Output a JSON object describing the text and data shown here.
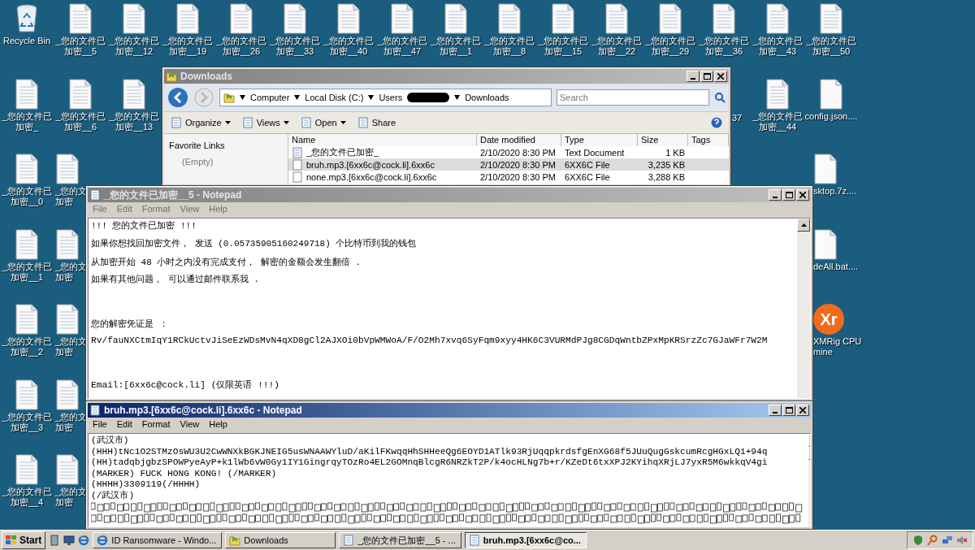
{
  "desktop_icons": [
    {
      "kind": "recycle_bin",
      "lines": [
        "Recycle Bin"
      ]
    },
    {
      "kind": "text_file",
      "lines": [
        "_您的文件已",
        "加密__5"
      ]
    },
    {
      "kind": "text_file",
      "lines": [
        "_您的文件已",
        "加密__12"
      ]
    },
    {
      "kind": "text_file",
      "lines": [
        "_您的文件已",
        "加密__19"
      ]
    },
    {
      "kind": "text_file",
      "lines": [
        "_您的文件已",
        "加密__26"
      ]
    },
    {
      "kind": "text_file",
      "lines": [
        "_您的文件已",
        "加密__33"
      ]
    },
    {
      "kind": "text_file",
      "lines": [
        "_您的文件已",
        "加密__40"
      ]
    },
    {
      "kind": "text_file",
      "lines": [
        "_您的文件已",
        "加密__47"
      ]
    },
    {
      "kind": "text_file",
      "lines": [
        "_您的文件已",
        "加密__1"
      ]
    },
    {
      "kind": "text_file",
      "lines": [
        "_您的文件已",
        "加密__8"
      ]
    },
    {
      "kind": "text_file",
      "lines": [
        "_您的文件已",
        "加密__15"
      ]
    },
    {
      "kind": "text_file",
      "lines": [
        "_您的文件已",
        "加密__22"
      ]
    },
    {
      "kind": "text_file",
      "lines": [
        "_您的文件已",
        "加密__29"
      ]
    },
    {
      "kind": "text_file",
      "lines": [
        "_您的文件已",
        "加密__36"
      ]
    },
    {
      "kind": "text_file",
      "lines": [
        "_您的文件已",
        "加密__43"
      ]
    },
    {
      "kind": "text_file",
      "lines": [
        "_您的文件已",
        "加密__50"
      ]
    },
    {
      "kind": "text_file",
      "lines": [
        "_您的文件已",
        "加密_"
      ]
    },
    {
      "kind": "text_file",
      "lines": [
        "_您的文件已",
        "加密__6"
      ]
    },
    {
      "kind": "text_file",
      "lines": [
        "_您的文件已",
        "加密__13"
      ]
    },
    {
      "kind": "text_file",
      "lines": [
        "37"
      ]
    },
    {
      "kind": "text_file",
      "lines": [
        "_您的文件已",
        "加密__44"
      ]
    },
    {
      "kind": "blank_file",
      "lines": [
        "config.json...."
      ]
    },
    {
      "kind": "text_file",
      "lines": [
        "_您的文件已",
        "加密__0"
      ]
    },
    {
      "kind": "text_file",
      "lines": [
        "_您的文",
        "加密"
      ]
    },
    {
      "kind": "blank_file",
      "lines": [
        "sktop.7z...."
      ]
    },
    {
      "kind": "text_file",
      "lines": [
        "_您的文件已",
        "加密__1"
      ]
    },
    {
      "kind": "text_file",
      "lines": [
        "_您的文",
        "加密"
      ]
    },
    {
      "kind": "blank_file",
      "lines": [
        "deAll.bat...."
      ]
    },
    {
      "kind": "text_file",
      "lines": [
        "_您的文件已",
        "加密__2"
      ]
    },
    {
      "kind": "text_file",
      "lines": [
        "_您的文",
        "加密"
      ]
    },
    {
      "kind": "app",
      "logo": "Xr",
      "lines": [
        "XMRig CPU",
        "mine"
      ]
    },
    {
      "kind": "text_file",
      "lines": [
        "_您的文件已",
        "加密__3"
      ]
    },
    {
      "kind": "text_file",
      "lines": [
        "_您的文",
        "加密"
      ]
    },
    {
      "kind": "text_file",
      "lines": [
        "_您的文件已",
        "加密__4"
      ]
    },
    {
      "kind": "text_file",
      "lines": [
        "_您的文",
        "加密"
      ]
    }
  ],
  "explorer": {
    "title": "Downloads",
    "active": false,
    "breadcrumb": [
      {
        "kind": "crumb",
        "label": "Computer"
      },
      {
        "kind": "crumb",
        "label": "Local Disk (C:)"
      },
      {
        "kind": "crumb",
        "label": "Users"
      },
      {
        "kind": "redacted"
      },
      {
        "kind": "crumb",
        "label": "Downloads"
      }
    ],
    "search": {
      "placeholder": "Search"
    },
    "toolbar": [
      {
        "label": "Organize",
        "dropdown": true
      },
      {
        "label": "Views",
        "dropdown": true
      },
      {
        "label": "Open",
        "dropdown": true
      },
      {
        "label": "Share",
        "dropdown": false
      }
    ],
    "sidebar": {
      "heading": "Favorite Links",
      "empty_note": "(Empty)"
    },
    "columns": [
      "Name",
      "Date modified",
      "Type",
      "Size",
      "Tags"
    ],
    "rows": [
      {
        "kind": "text",
        "name": "_您的文件已加密_",
        "date": "2/10/2020 8:30 PM",
        "type": "Text Document",
        "size": "1 KB",
        "selected": false
      },
      {
        "kind": "file",
        "name": "bruh.mp3.[6xx6c@cock.li].6xx6c",
        "date": "2/10/2020 8:30 PM",
        "type": "6XX6C File",
        "size": "3,235 KB",
        "selected": true
      },
      {
        "kind": "file",
        "name": "none.mp3.[6xx6c@cock.li].6xx6c",
        "date": "2/10/2020 8:30 PM",
        "type": "6XX6C File",
        "size": "3,288 KB",
        "selected": false
      }
    ]
  },
  "notepads": [
    {
      "title": "_您的文件已加密__5 - Notepad",
      "active": false,
      "menu": [
        "File",
        "Edit",
        "Format",
        "View",
        "Help"
      ],
      "garbled": false,
      "lines": [
        {
          "kind": "note",
          "text": "!!! 您的文件已加密 !!!"
        },
        {
          "kind": "note",
          "text": "如果你想找回加密文件， 发送 (0.05735905160249718) 个比特币到我的钱包"
        },
        {
          "kind": "note",
          "text": "从加密开始 48 小时之内没有完成支付， 解密的金额会发生翻倍 ."
        },
        {
          "kind": "note",
          "text": "如果有其他问题， 可以通过邮件联系我 ."
        },
        {
          "kind": "note",
          "text": "您的解密凭证是 ："
        },
        {
          "kind": "code",
          "text": "Rv/fauNXCtmIqY1RCkUctvJiSeEzWDsMvN4qXD8gCl2AJXOi0bVpWMWoA/F/O2Mh7xvq6SyFqm9xyy4HK6C3VURMdPJg8CGDqWntbZPxMpKRSrzZc7GJaWFr7W2M"
        },
        {
          "kind": "code",
          "text": "Email:[6xx6c@cock.li] (仅限英语 !!!)"
        }
      ]
    },
    {
      "title": "bruh.mp3.[6xx6c@cock.li].6xx6c - Notepad",
      "active": true,
      "menu": [
        "File",
        "Edit",
        "Format",
        "View",
        "Help"
      ],
      "garbled": true,
      "lines": [
        {
          "kind": "code",
          "text": "(武汉市)"
        },
        {
          "kind": "code",
          "text": "(HHH)tNc1O2STMzOsWU3U2CwWNXkBGKJNEIG5usWNAAWYluD/aKilFKwqqHhSHHeeQg6EOYD1ATlk93RjUqqpkrdsfgEnXG68f5JUuQugGskcumRcgHGxLQ1+94q"
        },
        {
          "kind": "code",
          "text": "(HH)tadqbjgbzSPOWPyeAyP+k1lWb6vW0Gy1IY1GingrqyTOzRo4EL2GOMnqBlcgR6NRZkT2P/k4ocHLNg7b+r/KZeDt6txXPJ2KYihqXRjLJ7yxR5M6wkkqV4gi"
        },
        {
          "kind": "code",
          "text": "(MARKER) FUCK HONG KONG! (/MARKER)"
        },
        {
          "kind": "code",
          "text": "(HHHH)3309119(/HHHH)"
        },
        {
          "kind": "code",
          "text": "(/武汉市)"
        }
      ]
    }
  ],
  "taskbar": {
    "start": "Start",
    "tasks": [
      {
        "kind": "browser",
        "label": "ID Ransomware - Windo...",
        "selected": false
      },
      {
        "kind": "folder",
        "label": "Downloads",
        "selected": false
      },
      {
        "kind": "notepad",
        "label": "_您的文件已加密__5 - ...",
        "selected": false
      },
      {
        "kind": "notepad",
        "label": "bruh.mp3.[6xx6c@co...",
        "selected": true
      }
    ]
  }
}
